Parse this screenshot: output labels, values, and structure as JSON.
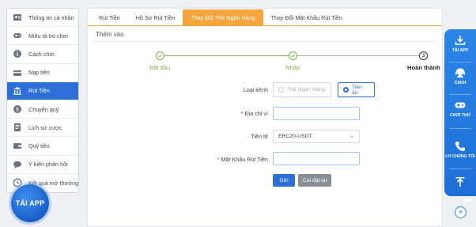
{
  "sidebar": {
    "items": [
      {
        "label": "Thông tin cá nhân",
        "icon": "user-icon"
      },
      {
        "label": "Miêu tả trò chơi",
        "icon": "gamepad-icon"
      },
      {
        "label": "Cách chơi",
        "icon": "info-icon"
      },
      {
        "label": "Nạp tiền",
        "icon": "deposit-icon"
      },
      {
        "label": "Rút Tiền",
        "icon": "bank-icon",
        "active": true
      },
      {
        "label": "Chuyển quỹ",
        "icon": "transfer-icon"
      },
      {
        "label": "Lịch sử cược",
        "icon": "history-doc-icon"
      },
      {
        "label": "Quỹ tiền",
        "icon": "wallet-icon"
      },
      {
        "label": "Ý kiến phản hồi",
        "icon": "chat-icon"
      },
      {
        "label": "Kết quả mở thưởng",
        "icon": "clock-icon"
      }
    ]
  },
  "app_badge": {
    "label": "TẢI APP"
  },
  "tabs": [
    "Rút Tiền",
    "Hồ Sơ Rút Tiền",
    "Thay Đổi Thẻ Ngân Hàng",
    "Thay Đổi Mật Khẩu Rút Tiền"
  ],
  "active_tab": 2,
  "section_title": "Thêm vào",
  "stepper": {
    "steps": [
      {
        "label": "Bắt đầu",
        "state": "done"
      },
      {
        "label": "Nhập",
        "state": "done"
      },
      {
        "label": "Hoàn thành",
        "state": "current",
        "number": "3"
      }
    ]
  },
  "form": {
    "channel_label": "Loại kênh",
    "channel_options": [
      {
        "label": "Thẻ Ngân Hàng",
        "selected": false
      },
      {
        "label": "Tiền ảo",
        "selected": true
      }
    ],
    "address_label": "Địa chỉ ví",
    "address_value": "",
    "currency_label": "Tiền tệ",
    "currency_value": "ERC20-USDT",
    "password_label": "Mật Khẩu Rút Tiền",
    "password_value": "",
    "submit_label": "Gửi",
    "reset_label": "Cài đặt lại"
  },
  "rightbar": {
    "items": [
      {
        "label": "TẢI APP",
        "icon": "download-icon"
      },
      {
        "label": "CSKH",
        "icon": "support-agent-icon"
      },
      {
        "label": "CHƠI THỬ",
        "icon": "gamepad-icon"
      },
      {
        "label": "LH CHÚNG TÔI",
        "icon": "phone-icon"
      },
      {
        "label": "",
        "icon": "arrow-up-icon"
      }
    ]
  },
  "colors": {
    "primary": "#2c6fd6",
    "tab_active": "#f5a53a",
    "step_done": "#7ab648",
    "rightbar": "#2b86e6"
  }
}
